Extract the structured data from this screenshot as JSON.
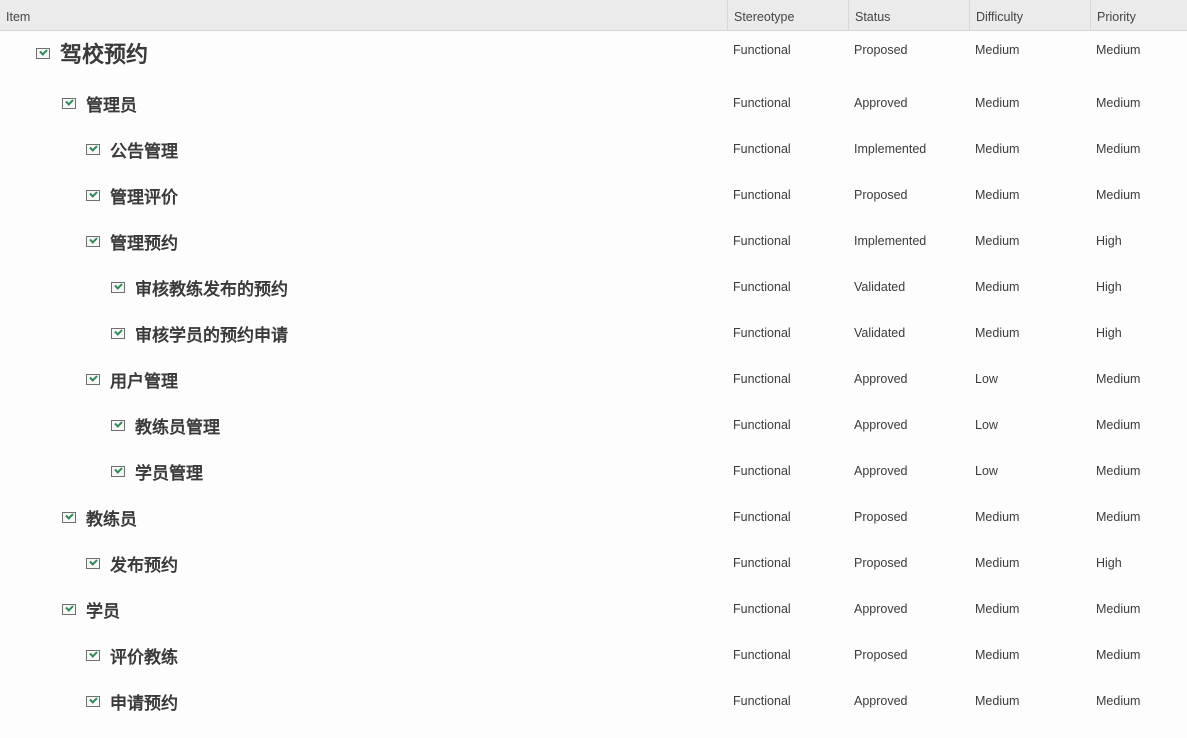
{
  "columns": {
    "item": "Item",
    "stereotype": "Stereotype",
    "status": "Status",
    "difficulty": "Difficulty",
    "priority": "Priority"
  },
  "rows": [
    {
      "name": "驾校预约",
      "stereotype": "Functional",
      "status": "Proposed",
      "difficulty": "Medium",
      "priority": "Medium"
    },
    {
      "name": "管理员",
      "stereotype": "Functional",
      "status": "Approved",
      "difficulty": "Medium",
      "priority": "Medium"
    },
    {
      "name": "公告管理",
      "stereotype": "Functional",
      "status": "Implemented",
      "difficulty": "Medium",
      "priority": "Medium"
    },
    {
      "name": "管理评价",
      "stereotype": "Functional",
      "status": "Proposed",
      "difficulty": "Medium",
      "priority": "Medium"
    },
    {
      "name": "管理预约",
      "stereotype": "Functional",
      "status": "Implemented",
      "difficulty": "Medium",
      "priority": "High"
    },
    {
      "name": "审核教练发布的预约",
      "stereotype": "Functional",
      "status": "Validated",
      "difficulty": "Medium",
      "priority": "High"
    },
    {
      "name": "审核学员的预约申请",
      "stereotype": "Functional",
      "status": "Validated",
      "difficulty": "Medium",
      "priority": "High"
    },
    {
      "name": "用户管理",
      "stereotype": "Functional",
      "status": "Approved",
      "difficulty": "Low",
      "priority": "Medium"
    },
    {
      "name": "教练员管理",
      "stereotype": "Functional",
      "status": "Approved",
      "difficulty": "Low",
      "priority": "Medium"
    },
    {
      "name": "学员管理",
      "stereotype": "Functional",
      "status": "Approved",
      "difficulty": "Low",
      "priority": "Medium"
    },
    {
      "name": "教练员",
      "stereotype": "Functional",
      "status": "Proposed",
      "difficulty": "Medium",
      "priority": "Medium"
    },
    {
      "name": "发布预约",
      "stereotype": "Functional",
      "status": "Proposed",
      "difficulty": "Medium",
      "priority": "High"
    },
    {
      "name": "学员",
      "stereotype": "Functional",
      "status": "Approved",
      "difficulty": "Medium",
      "priority": "Medium"
    },
    {
      "name": "评价教练",
      "stereotype": "Functional",
      "status": "Proposed",
      "difficulty": "Medium",
      "priority": "Medium"
    },
    {
      "name": "申请预约",
      "stereotype": "Functional",
      "status": "Approved",
      "difficulty": "Medium",
      "priority": "Medium"
    }
  ]
}
